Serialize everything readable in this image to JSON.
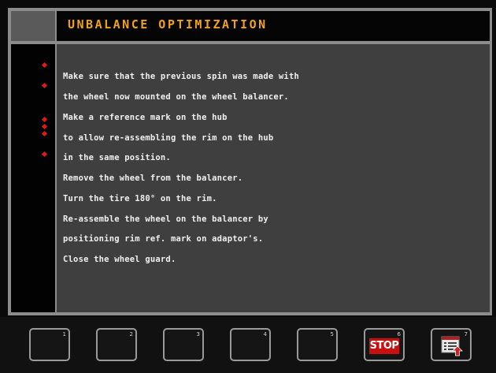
{
  "header": {
    "title": "UNBALANCE OPTIMIZATION"
  },
  "instructions": {
    "lines": [
      "Make sure that the previous spin was made with",
      "the wheel now mounted on the wheel balancer.",
      "Make a reference mark on the hub",
      "to allow re-assembling the rim on the hub",
      "in the same position.",
      "Remove the wheel from the balancer.",
      "Turn the tire 180° on the rim.",
      "Re-assemble the wheel on the balancer by",
      "positioning rim ref. mark on adaptor's.",
      "Close the wheel guard."
    ],
    "bullet_color": "#e01a1a"
  },
  "function_keys": [
    {
      "num": "1",
      "label": ""
    },
    {
      "num": "2",
      "label": ""
    },
    {
      "num": "3",
      "label": ""
    },
    {
      "num": "4",
      "label": ""
    },
    {
      "num": "5",
      "label": ""
    },
    {
      "num": "6",
      "label": "STOP",
      "icon": "stop-icon"
    },
    {
      "num": "7",
      "label": "",
      "icon": "document-upload-icon"
    }
  ],
  "colors": {
    "title": "#f2a21a",
    "panel": "#3f3f3f",
    "stop": "#c81010"
  }
}
